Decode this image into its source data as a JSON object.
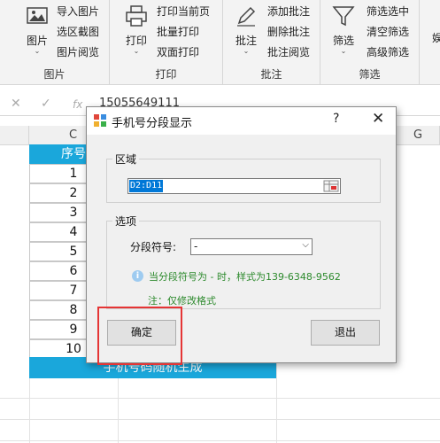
{
  "ribbon": {
    "groups": [
      {
        "label": "图片",
        "big_button": "图片",
        "items": [
          "导入图片",
          "选区截图",
          "图片阅览"
        ]
      },
      {
        "label": "打印",
        "big_button": "打印",
        "items": [
          "打印当前页",
          "批量打印",
          "双面打印"
        ]
      },
      {
        "label": "批注",
        "big_button": "批注",
        "items": [
          "添加批注",
          "删除批注",
          "批注阅览"
        ]
      },
      {
        "label": "筛选",
        "big_button": "筛选",
        "items": [
          "筛选选中",
          "清空筛选",
          "高级筛选"
        ]
      }
    ],
    "partial_glyph": "娱"
  },
  "formula_bar": {
    "cancel_symbol": "✕",
    "confirm_symbol": "✓",
    "fx_symbol": "fx",
    "value": "15055649111"
  },
  "sheet": {
    "column_headers": [
      "C",
      "G"
    ],
    "left_partial_header": "",
    "table": {
      "header": "序号",
      "rows": [
        "1",
        "2",
        "3",
        "4",
        "5",
        "6",
        "7",
        "8",
        "9",
        "10"
      ],
      "banner": "手机号码随机生成"
    }
  },
  "dialog": {
    "title": "手机号分段显示",
    "help": "?",
    "close": "✕",
    "section_range": {
      "label": "区域",
      "value": "D2:D11"
    },
    "section_options": {
      "label": "选项",
      "separator_label": "分段符号:",
      "separator_value": "-",
      "info": "当分段符号为 - 时，样式为139-6348-9562",
      "note": "注：仅修改格式"
    },
    "ok_button": "确定",
    "exit_button": "退出"
  },
  "colors": {
    "table_header": "#1aa7db",
    "highlight": "#e53535",
    "info_text": "#2d8a2d"
  }
}
